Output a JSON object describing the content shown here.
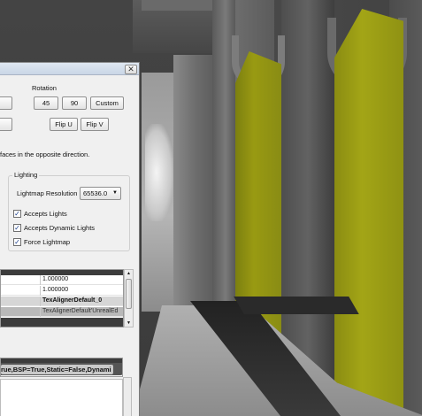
{
  "dialog": {
    "close_glyph": "✕",
    "rotation_label": "Rotation",
    "buttons": {
      "partial_1": "",
      "partial_2": "",
      "r45": "45",
      "r90": "90",
      "custom": "Custom",
      "flip_u": "Flip U",
      "flip_v": "Flip V"
    },
    "faces_text": "faces in the opposite direction.",
    "lighting": {
      "group_label": "Lighting",
      "lightmap_label": "Lightmap Resolution",
      "lightmap_value": "65536.0",
      "checkboxes": [
        {
          "label": "Accepts Lights",
          "checked": true
        },
        {
          "label": "Accepts Dynamic Lights",
          "checked": true
        },
        {
          "label": "Force Lightmap",
          "checked": true
        }
      ],
      "check_glyph": "✓"
    },
    "property_grid": {
      "rows": [
        {
          "value": "1.000000"
        },
        {
          "value": "1.000000"
        },
        {
          "value": "TexAlignerDefault_0"
        },
        {
          "value": "TexAlignerDefault'UnrealEd"
        }
      ]
    },
    "bottom_field_text": "rue,BSP=True,Static=False,Dynami"
  },
  "colors": {
    "dialog_bg": "#f0f0f0",
    "yellow_panel": "#9c9e14",
    "grid_header": "#3c3c3c"
  }
}
